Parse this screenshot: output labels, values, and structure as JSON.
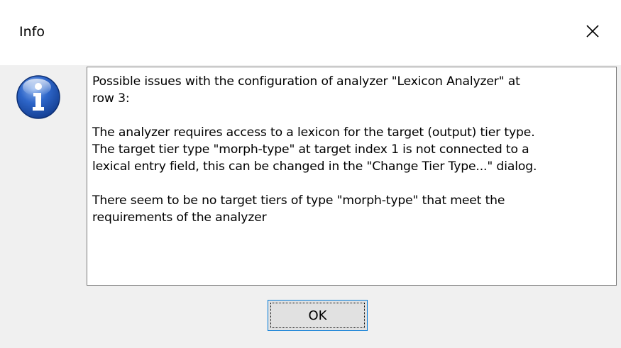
{
  "window": {
    "title": "Info"
  },
  "icons": {
    "info": "info-icon",
    "close": "close-icon"
  },
  "message": {
    "paragraph1": "Possible issues with the configuration of analyzer \"Lexicon Analyzer\" at\nrow 3:",
    "paragraph2": "The analyzer requires access to a lexicon for the target (output) tier type.\nThe target tier type \"morph-type\" at target index 1 is not connected to a\nlexical entry field, this can be changed in the \"Change Tier Type...\" dialog.",
    "paragraph3": "There seem to be no target tiers of type \"morph-type\" that meet the\nrequirements of the analyzer"
  },
  "buttons": {
    "ok_label": "OK"
  },
  "colors": {
    "title_bar": "#ffffff",
    "dialog_body": "#f0f0f0",
    "message_background": "#ffffff",
    "message_border": "#7a7a7a",
    "button_face": "#e1e1e1",
    "button_focus_border": "#0078d7",
    "info_icon_blue": "#1f56b8"
  }
}
